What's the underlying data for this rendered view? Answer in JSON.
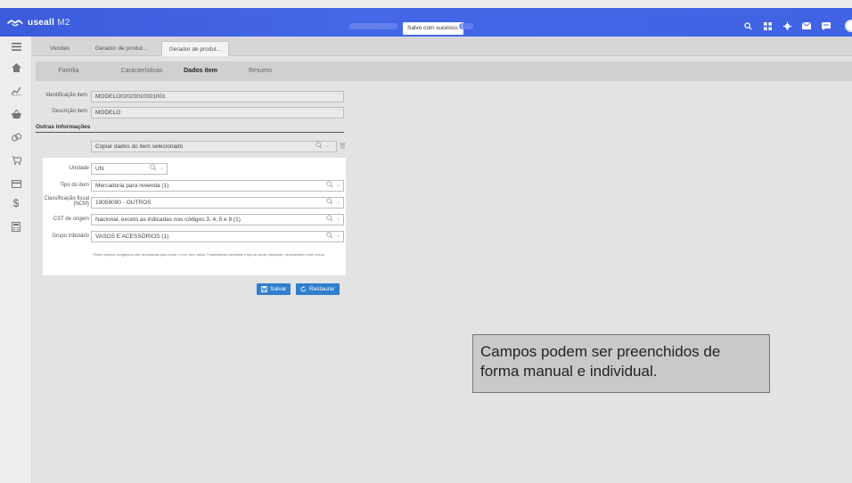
{
  "app": {
    "logo_text": "useall",
    "logo_suffix": "M2",
    "toast": "Salvo com sucesso."
  },
  "top_icons": [
    "search-icon",
    "grid-icon",
    "settings-icon",
    "mail-icon",
    "chat-icon"
  ],
  "sidebar": {
    "items": [
      "menu-icon",
      "home-icon",
      "chart-icon",
      "basket-icon",
      "coins-icon",
      "cart-icon",
      "card-icon",
      "dollar-icon",
      "calculator-icon"
    ]
  },
  "tabs": [
    {
      "label": "Vendas"
    },
    {
      "label": "Gerador de produt..."
    },
    {
      "label": "Gerador de produt..."
    }
  ],
  "subtabs": [
    {
      "label": "Família"
    },
    {
      "label": "Características"
    },
    {
      "label": "Dados item"
    },
    {
      "label": "Resumo"
    }
  ],
  "form": {
    "identificacao_label": "Identificação item",
    "identificacao_value": "MODELO02020010301001",
    "descricao_label": "Descrição item",
    "descricao_value": "MODELO",
    "section_title": "Outras informações",
    "copiar_value": "Copiar dados do item selecionado",
    "unidade_label": "Unidade",
    "unidade_value": "UN",
    "tipo_label": "Tipo do item",
    "tipo_value": "Mercadoria para revenda (1)",
    "ncm_label_1": "Classificação fiscal",
    "ncm_label_2": "(NCM)",
    "ncm_value": "19059090 - OUTROS",
    "cst_label": "CST de origem",
    "cst_value": "Nacional, exceto as indicadas nos códigos 3, 4, 5 e 8 (1)",
    "grupo_label": "Grupo tributário",
    "grupo_value": "VASOS E ACESSÓRIOS (1)",
    "note": "*Estes campos obrigatórios são necessários para tornar o novo item válido. Possibilitando identificar o tipo de saída, tributação, almoxarifado, entre outros"
  },
  "buttons": {
    "salvar": "Salvar",
    "restaurar": "Restaurar"
  },
  "tooltip": {
    "text": "Campos podem ser preenchidos de forma manual e individual."
  },
  "colors": {
    "topbar": "#3f63e4",
    "button": "#2f7fce"
  }
}
